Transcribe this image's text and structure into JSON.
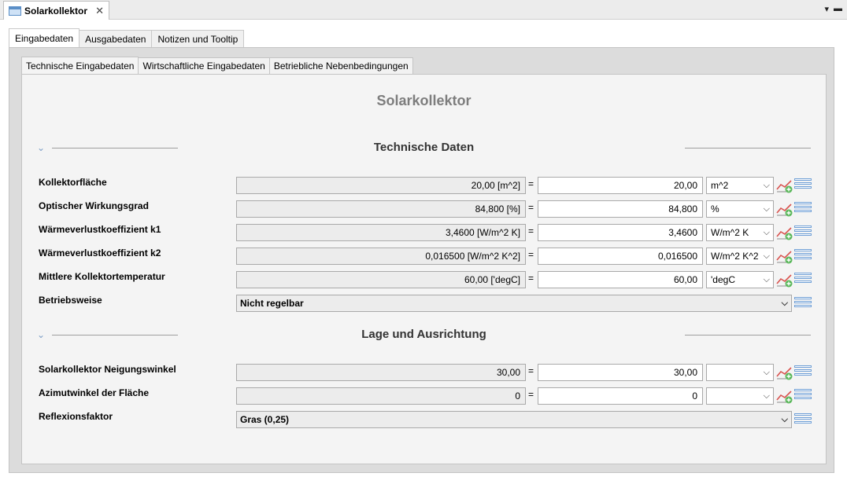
{
  "editor": {
    "tab_title": "Solarkollektor",
    "close": "✕",
    "menu": "▾",
    "minimize": "▬"
  },
  "outer_tabs": [
    "Eingabedaten",
    "Ausgabedaten",
    "Notizen und Tooltip"
  ],
  "inner_tabs": [
    "Technische Eingabedaten",
    "Wirtschaftliche Eingabedaten",
    "Betriebliche Nebenbedingungen"
  ],
  "form": {
    "title": "Solarkollektor"
  },
  "sections": [
    {
      "title": "Technische Daten",
      "chevron": "⌄"
    },
    {
      "title": "Lage und Ausrichtung",
      "chevron": "⌄"
    }
  ],
  "rows": [
    {
      "label": "Kollektorfläche",
      "display": "20,00 [m^2]",
      "eq": "=",
      "value": "20,00",
      "unit": "m^2"
    },
    {
      "label": "Optischer Wirkungsgrad",
      "display": "84,800 [%]",
      "eq": "=",
      "value": "84,800",
      "unit": "%"
    },
    {
      "label": "Wärmeverlustkoeffizient k1",
      "display": "3,4600 [W/m^2 K]",
      "eq": "=",
      "value": "3,4600",
      "unit": "W/m^2 K"
    },
    {
      "label": "Wärmeverlustkoeffizient k2",
      "display": "0,016500 [W/m^2 K^2]",
      "eq": "=",
      "value": "0,016500",
      "unit": "W/m^2 K^2"
    },
    {
      "label": "Mittlere Kollektortemperatur",
      "display": "60,00 ['degC]",
      "eq": "=",
      "value": "60,00",
      "unit": "'degC"
    },
    {
      "label": "Betriebsweise",
      "select": "Nicht regelbar"
    },
    {
      "label": "Solarkollektor Neigungswinkel",
      "display": "30,00",
      "eq": "=",
      "value": "30,00",
      "unit": ""
    },
    {
      "label": "Azimutwinkel der Fläche",
      "display": "0",
      "eq": "=",
      "value": "0",
      "unit": ""
    },
    {
      "label": "Reflexionsfaktor",
      "select": "Gras (0,25)"
    }
  ],
  "icons": {
    "dropdown": "chevron-down-icon",
    "chart": "line-chart-add-icon",
    "list": "list-icon"
  },
  "colors": {
    "title_gray": "#7d7d7d",
    "icon_blue": "#6f9fd6",
    "chart_red": "#d9534f",
    "chart_green": "#5cb85c"
  }
}
